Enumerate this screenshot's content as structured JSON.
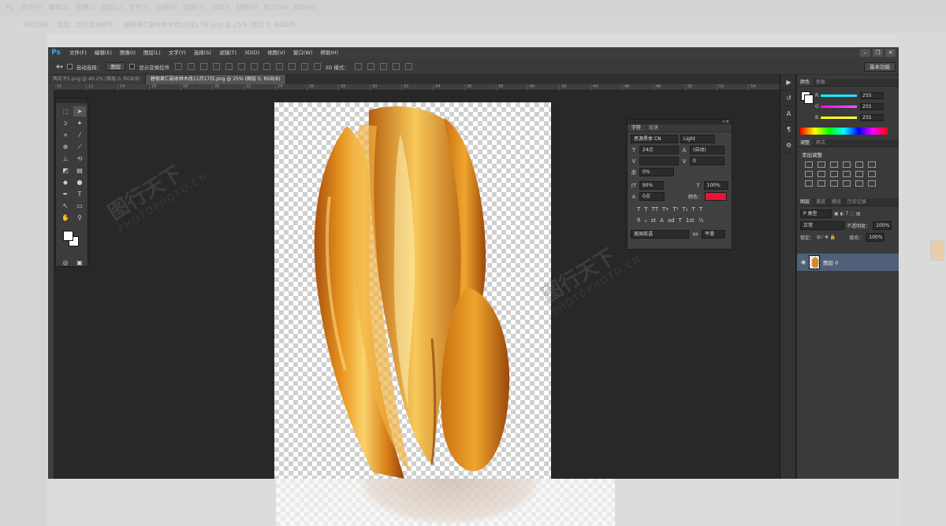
{
  "background": {
    "menu_items": [
      "文件(F)",
      "编辑(E)",
      "图像(I)",
      "图层(L)",
      "文字(Y)",
      "选择(S)",
      "滤镜(T)",
      "3D(D)",
      "视图(V)",
      "窗口(W)",
      "帮助(H)"
    ],
    "auto_select_label": "自动选择：",
    "auto_select_value": "图层",
    "show_transform_label": "显示变换控件",
    "tab_label": "碧根果仁副本林木改11月17日.png @ 25% (图层 0, RGB/8)"
  },
  "app": {
    "logo": "Ps",
    "menus": [
      "文件(F)",
      "编辑(E)",
      "图像(I)",
      "图层(L)",
      "文字(Y)",
      "选择(S)",
      "滤镜(T)",
      "3D(D)",
      "视图(V)",
      "窗口(W)",
      "帮助(H)"
    ],
    "window_buttons": [
      "–",
      "❐",
      "✕"
    ],
    "workspace": "基本功能"
  },
  "options_bar": {
    "auto_select_label": "自动选择：",
    "auto_select_value": "图层",
    "show_transform_label": "显示变换控件",
    "mode_3d_label": "3D 模式："
  },
  "tabs": [
    {
      "label": "两瓜子2.png @ 40.2% (图层 0, RGB/8)",
      "active": false
    },
    {
      "label": "碧根果仁副本林木改11月17日.png @ 25% (图层 0, RGB/8)",
      "active": true
    }
  ],
  "ruler_ticks": [
    "10",
    "12",
    "14",
    "16",
    "18",
    "20",
    "22",
    "24",
    "26",
    "28",
    "30",
    "32",
    "34",
    "36",
    "38",
    "40",
    "42",
    "44",
    "46",
    "48",
    "50",
    "52",
    "54"
  ],
  "watermark": {
    "cn": "图行天下",
    "en": "PHOTOPHOTO.CN"
  },
  "character_panel": {
    "tabs": [
      "字符",
      "段落"
    ],
    "font_family": "思源黑体 CN",
    "font_style": "Light",
    "font_size": "24点",
    "leading": "(自动)",
    "kerning": "",
    "tracking": "0",
    "tsume": "0%",
    "vertical_scale": "90%",
    "horizontal_scale": "100%",
    "baseline_shift": "0点",
    "color_label": "颜色：",
    "text_color": "#ee1037",
    "style_buttons": [
      "T",
      "T",
      "TT",
      "Tт",
      "T¹",
      "T₁",
      "T",
      "T"
    ],
    "extra_buttons": [
      "fi",
      "ℴ",
      "st",
      "A",
      "ad",
      "T",
      "1st",
      "½"
    ],
    "language": "美国英语",
    "aa_label": "aa",
    "antialias": "平滑"
  },
  "color_panel": {
    "tabs": [
      "颜色",
      "色板"
    ],
    "channels": [
      {
        "label": "R",
        "value": "255",
        "gradient": "#35d8ff"
      },
      {
        "label": "G",
        "value": "255",
        "gradient": "#ff58ff"
      },
      {
        "label": "B",
        "value": "255",
        "gradient": "#ffff50"
      }
    ]
  },
  "adjustments_panel": {
    "tabs": [
      "调整",
      "样式"
    ],
    "title": "添加调整"
  },
  "layers_panel": {
    "tabs": [
      "图层",
      "通道",
      "路径",
      "历史记录"
    ],
    "filter_label": "P 类型",
    "blend_mode": "正常",
    "opacity_label": "不透明度：",
    "opacity": "100%",
    "lock_label": "锁定：",
    "fill_label": "填充：",
    "fill": "100%",
    "layers": [
      {
        "name": "图层 0"
      }
    ]
  }
}
